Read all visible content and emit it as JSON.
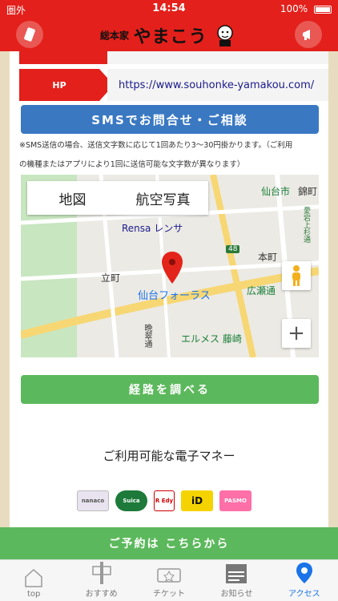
{
  "status": {
    "carrier": "圏外",
    "time": "14:54",
    "battery": "100%"
  },
  "header": {
    "logo_small": "総本家",
    "logo_big": "やまこう"
  },
  "hp": {
    "label": "HP",
    "url": "https://www.souhonke-yamakou.com/"
  },
  "sms": {
    "button": "SMSでお問合せ・ご相談",
    "note1": "※SMS送信の場合、送信文字数に応じて1回あたり3〜30円掛かります。（ご利用",
    "note2": "の機種またはアプリにより1回に送信可能な文字数が異なります）"
  },
  "map": {
    "tab_map": "地図",
    "tab_aerial": "航空写真",
    "labels": [
      "仙台市",
      "錦町",
      "Rensa レンサ",
      "立町",
      "本町",
      "仙台フォーラス",
      "広瀬通",
      "エルメス 藤崎",
      "晩翠通",
      "48",
      "愛宕上杉通"
    ]
  },
  "route_button": "経路を調べる",
  "emoney": {
    "title": "ご利用可能な電子マネー",
    "cards": [
      "nanaco",
      "Suica",
      "R Edy",
      "iD",
      "PASMO"
    ]
  },
  "reserve_button": "ご予約は こちらから",
  "tabs": [
    "top",
    "おすすめ",
    "チケット",
    "お知らせ",
    "アクセス"
  ],
  "colors": {
    "brand_red": "#e3201b",
    "sms_blue": "#3a78c2",
    "green": "#5cb85c",
    "active_tab": "#1a73e8"
  }
}
